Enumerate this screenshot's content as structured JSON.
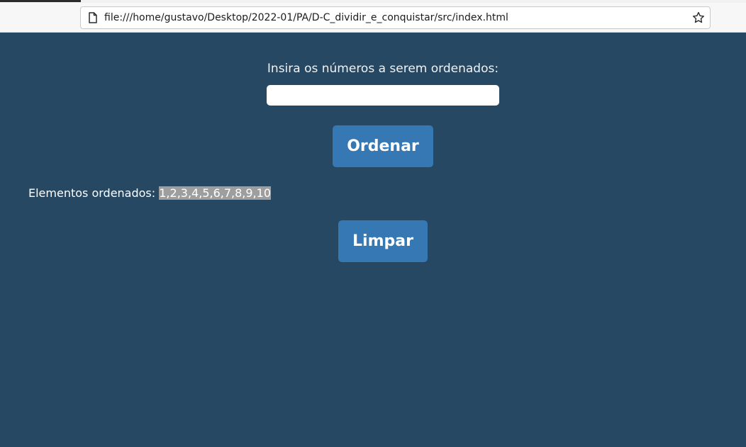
{
  "browser": {
    "url": "file:///home/gustavo/Desktop/2022-01/PA/D-C_dividir_e_conquistar/src/index.html",
    "icons": {
      "page": "page-icon",
      "bookmark": "star-icon"
    }
  },
  "main": {
    "prompt_label": "Insira os números a serem ordenados:",
    "input_value": "",
    "order_button_label": "Ordenar",
    "result_label": "Elementos ordenados:",
    "result_values": "1,2,3,4,5,6,7,8,9,10",
    "clear_button_label": "Limpar"
  },
  "colors": {
    "page_background": "#264863",
    "button_background": "#3578b3",
    "selection_highlight": "#9e9e9e"
  }
}
